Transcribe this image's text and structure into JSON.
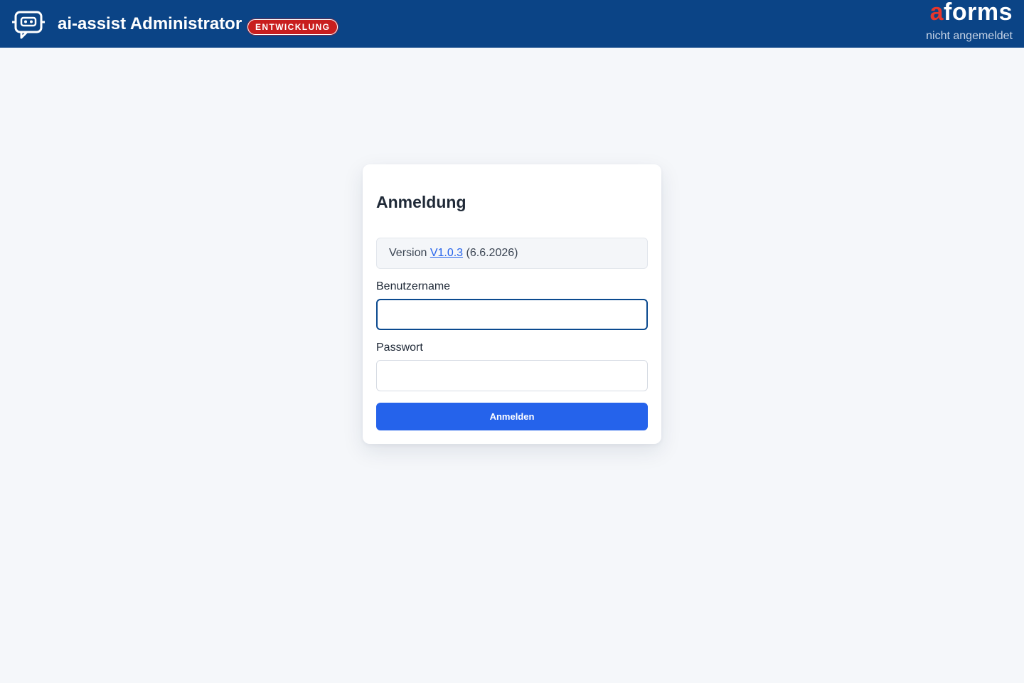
{
  "header": {
    "app_title": "ai-assist Administrator",
    "environment_badge": "ENTWICKLUNG",
    "brand_accent": "a",
    "brand_rest": "forms",
    "login_status": "nicht angemeldet",
    "logo_icon": "chat-bot-icon"
  },
  "login": {
    "title": "Anmeldung",
    "version_prefix": "Version ",
    "version_link": "V1.0.3",
    "version_date": " (6.6.2026)",
    "username_label": "Benutzername",
    "username_value": "",
    "password_label": "Passwort",
    "password_value": "",
    "submit_label": "Anmelden"
  },
  "colors": {
    "header_bg": "#0b4486",
    "badge_bg": "#c81e1e",
    "brand_accent": "#e6362c",
    "primary": "#2563eb",
    "page_bg": "#f5f7fa"
  }
}
